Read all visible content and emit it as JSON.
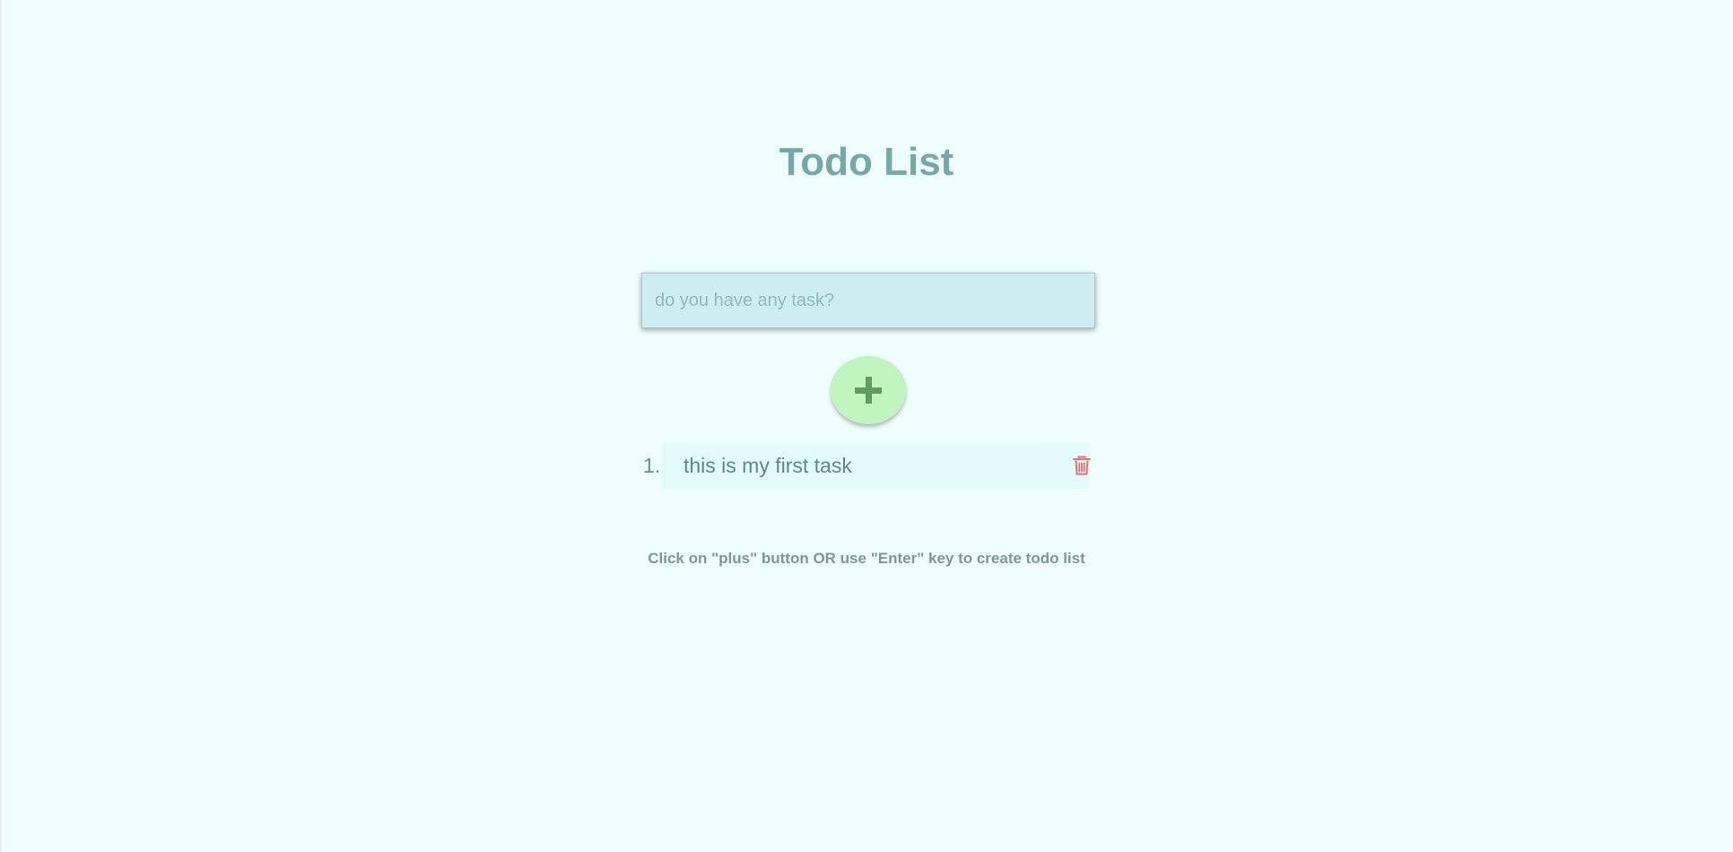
{
  "page": {
    "title": "Todo List",
    "hint": "Click on \"plus\" button OR use \"Enter\" key to create todo list"
  },
  "form": {
    "input_placeholder": "do you have any task?",
    "input_value": "",
    "add_button_icon": "plus-icon"
  },
  "todos": [
    {
      "index": "1.",
      "text": "this is my first task",
      "delete_icon": "trash-icon"
    }
  ],
  "colors": {
    "background": "#effefe",
    "title": "#74a9a9",
    "input_background": "#cceeee",
    "add_button": "#c0f5be",
    "plus": "#5f9c5e",
    "delete": "#e96f6f"
  }
}
